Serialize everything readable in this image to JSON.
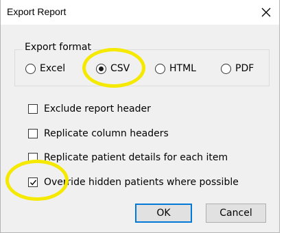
{
  "dialog": {
    "title": "Export Report",
    "close_icon": "close-icon"
  },
  "export_format": {
    "legend": "Export format",
    "options": [
      {
        "label": "Excel",
        "selected": false
      },
      {
        "label": "CSV",
        "selected": true
      },
      {
        "label": "HTML",
        "selected": false
      },
      {
        "label": "PDF",
        "selected": false
      }
    ]
  },
  "checkboxes": [
    {
      "label": "Exclude report header",
      "checked": false
    },
    {
      "label": "Replicate column headers",
      "checked": false
    },
    {
      "label": "Replicate patient details for each item",
      "checked": false
    },
    {
      "label": "Override hidden patients where possible",
      "checked": true
    }
  ],
  "buttons": {
    "ok": "OK",
    "cancel": "Cancel"
  },
  "colors": {
    "highlight": "#f5e900",
    "dialog_bg": "#f0f0f0",
    "default_button_border": "#0078d7"
  }
}
